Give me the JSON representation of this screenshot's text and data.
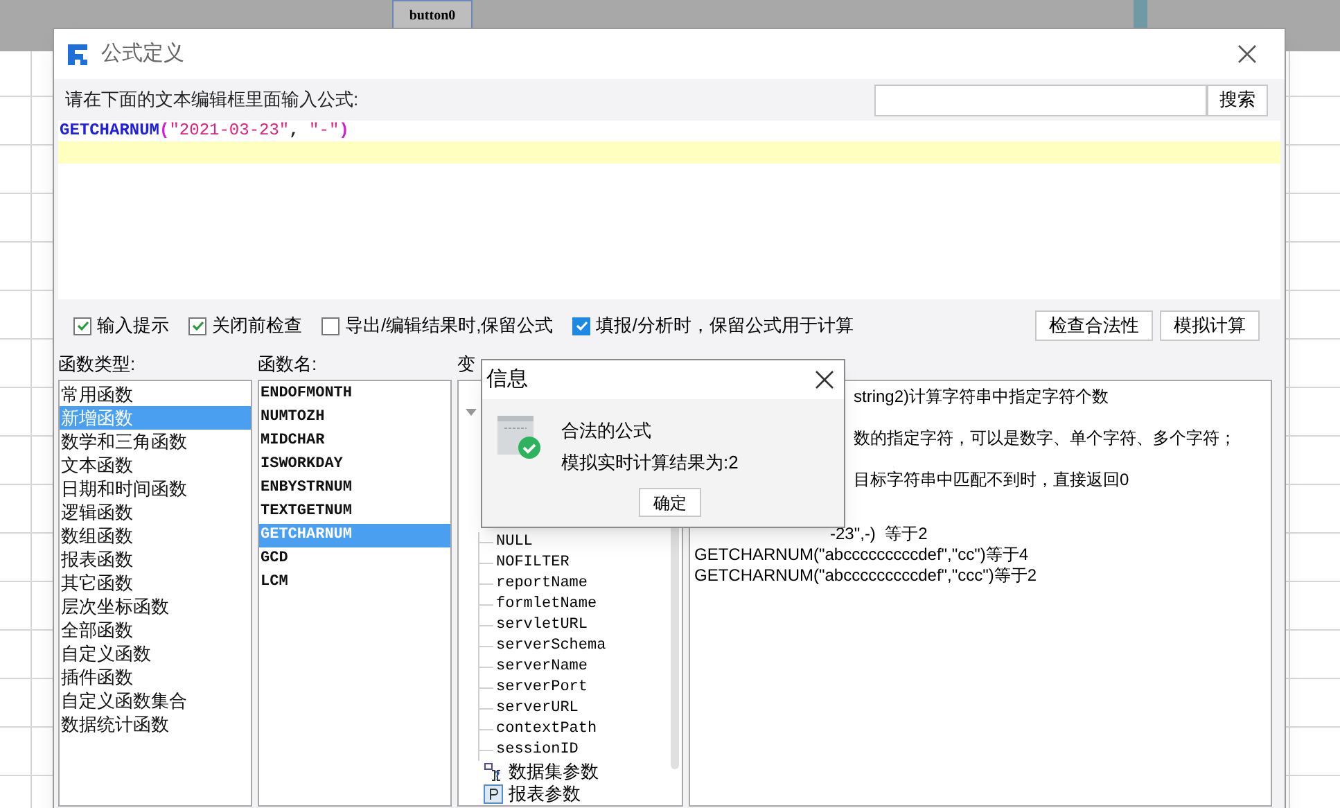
{
  "background": {
    "widget_label": "button0"
  },
  "dialog": {
    "title": "公式定义",
    "instruction": "请在下面的文本编辑框里面输入公式:",
    "search": {
      "button": "搜索"
    },
    "formula": [
      {
        "text": "GETCHARNUM",
        "kind": "function"
      },
      {
        "text": "(",
        "kind": "paren"
      },
      {
        "text": "\"2021-03-23\"",
        "kind": "string"
      },
      {
        "text": ", ",
        "kind": "plain"
      },
      {
        "text": "\"-\"",
        "kind": "string"
      },
      {
        "text": ")",
        "kind": "paren"
      }
    ],
    "options": [
      {
        "label": "输入提示",
        "checked": true,
        "kind": "outlined"
      },
      {
        "label": "关闭前检查",
        "checked": true,
        "kind": "outlined"
      },
      {
        "label": "导出/编辑结果时,保留公式",
        "checked": false,
        "kind": "outlined"
      },
      {
        "label": "填报/分析时，保留公式用于计算",
        "checked": true,
        "kind": "filled"
      }
    ],
    "buttons": [
      "检查合法性",
      "模拟计算"
    ],
    "function_types": {
      "header": "函数类型:",
      "items": [
        {
          "label": "常用函数",
          "selected": false
        },
        {
          "label": "新增函数",
          "selected": true
        },
        {
          "label": "数学和三角函数",
          "selected": false
        },
        {
          "label": "文本函数",
          "selected": false
        },
        {
          "label": "日期和时间函数",
          "selected": false
        },
        {
          "label": "逻辑函数",
          "selected": false
        },
        {
          "label": "数组函数",
          "selected": false
        },
        {
          "label": "报表函数",
          "selected": false
        },
        {
          "label": "其它函数",
          "selected": false
        },
        {
          "label": "层次坐标函数",
          "selected": false
        },
        {
          "label": "全部函数",
          "selected": false
        },
        {
          "label": "自定义函数",
          "selected": false
        },
        {
          "label": "插件函数",
          "selected": false
        },
        {
          "label": "自定义函数集合",
          "selected": false
        },
        {
          "label": "数据统计函数",
          "selected": false
        }
      ]
    },
    "function_names": {
      "header": "函数名:",
      "items": [
        {
          "label": "ENDOFMONTH",
          "selected": false
        },
        {
          "label": "NUMTOZH",
          "selected": false
        },
        {
          "label": "MIDCHAR",
          "selected": false
        },
        {
          "label": "ISWORKDAY",
          "selected": false
        },
        {
          "label": "ENBYSTRNUM",
          "selected": false
        },
        {
          "label": "TEXTGETNUM",
          "selected": false
        },
        {
          "label": "GETCHARNUM",
          "selected": true
        },
        {
          "label": "GCD",
          "selected": false
        },
        {
          "label": "LCM",
          "selected": false
        }
      ]
    },
    "variables": {
      "header": "变",
      "items": [
        "NULL",
        "NOFILTER",
        "reportName",
        "formletName",
        "servletURL",
        "serverSchema",
        "serverName",
        "serverPort",
        "serverURL",
        "contextPath",
        "sessionID"
      ],
      "groups": [
        {
          "label": "数据集参数",
          "kind": "dataset"
        },
        {
          "label": "报表参数",
          "kind": "report"
        }
      ]
    },
    "description": {
      "lines": [
        {
          "text": "string2)计算字符串中指定字符个数",
          "kind": "clipped"
        },
        {
          "text": "数的指定字符，可以是数字、单个字符、多个字符；",
          "kind": "clipped"
        },
        {
          "text": "目标字符串中匹配不到时，直接返回0",
          "kind": "clipped"
        },
        {
          "text": "-23\",-)  等于2",
          "kind": "partial"
        },
        {
          "text": "GETCHARNUM(\"abcccccccccdef\",\"cc\")等于4",
          "kind": "full"
        },
        {
          "text": "GETCHARNUM(\"abcccccccccdef\",\"ccc\")等于2",
          "kind": "full"
        }
      ]
    }
  },
  "message_box": {
    "title": "信息",
    "lines": [
      "合法的公式",
      "模拟实时计算结果为:2"
    ],
    "button": "确定"
  }
}
